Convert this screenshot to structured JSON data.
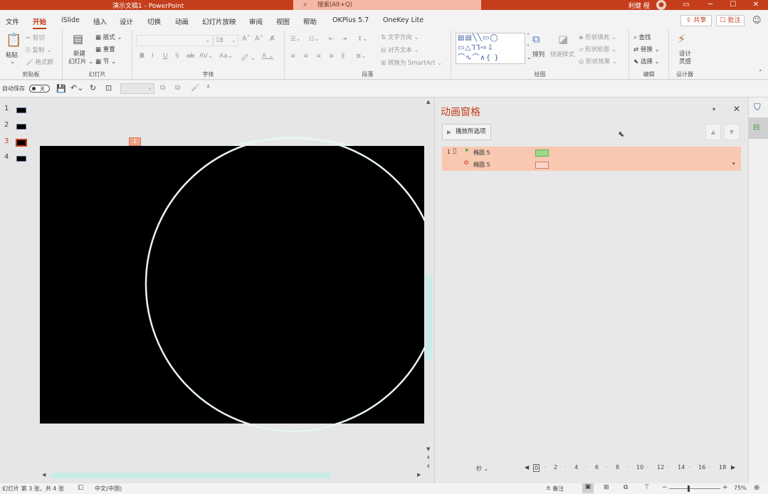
{
  "title_bar": {
    "doc_title": "演示文稿1 - PowerPoint",
    "search_placeholder": "搜索(Alt+Q)",
    "user_name": "利健 程",
    "colors": {
      "accent": "#c43e1c",
      "search_bg": "#f4b9a6"
    }
  },
  "menu": {
    "tabs": [
      "文件",
      "开始",
      "iSlide",
      "插入",
      "设计",
      "切换",
      "动画",
      "幻灯片放映",
      "审阅",
      "视图",
      "帮助",
      "OKPlus 5.7",
      "OneKey Lite"
    ],
    "active_tab": "开始",
    "share_label": "共享",
    "comment_label": "批注"
  },
  "ribbon": {
    "clipboard": {
      "label": "剪贴板",
      "paste": "粘贴",
      "cut": "剪切",
      "copy": "复制",
      "format_painter": "格式刷"
    },
    "slides": {
      "label": "幻灯片",
      "new_slide_1": "新建",
      "new_slide_2": "幻灯片",
      "layout": "版式",
      "reset": "重置",
      "section": "节"
    },
    "font": {
      "label": "字体",
      "size": "18"
    },
    "paragraph": {
      "label": "段落",
      "text_direction": "文字方向",
      "align_text": "对齐文本",
      "smartart": "转换为 SmartArt"
    },
    "drawing": {
      "label": "绘图",
      "arrange": "排列",
      "quick_styles": "快速样式",
      "shape_fill": "形状填充",
      "shape_outline": "形状轮廓",
      "shape_effects": "形状效果"
    },
    "editing": {
      "label": "编辑",
      "find": "查找",
      "replace": "替换",
      "select": "选择"
    },
    "designer": {
      "label": "设计器",
      "design_ideas_1": "设计",
      "design_ideas_2": "灵感"
    }
  },
  "qat": {
    "autosave_label": "自动保存",
    "autosave_state": "关"
  },
  "thumbnails": {
    "numbers": [
      "1",
      "2",
      "3",
      "4"
    ],
    "selected": "3"
  },
  "slide": {
    "animation_marker": "1"
  },
  "animation_pane": {
    "title": "动画窗格",
    "play_button": "播放所选项",
    "items": [
      {
        "number": "1",
        "name": "椭圆 5",
        "bar_color": "#9bd88a",
        "effect": "entrance"
      },
      {
        "number": "",
        "name": "椭圆 5",
        "bar_color": "#f9d6cc",
        "effect": "emphasis"
      }
    ],
    "time_unit": "秒",
    "timeline_ticks": [
      "0",
      "2",
      "4",
      "6",
      "8",
      "10",
      "12",
      "14",
      "16",
      "18"
    ]
  },
  "status_bar": {
    "slide_info": "幻灯片 第 3 张，共 4 张",
    "language": "中文(中国)",
    "notes_label": "备注",
    "zoom": "75%"
  }
}
